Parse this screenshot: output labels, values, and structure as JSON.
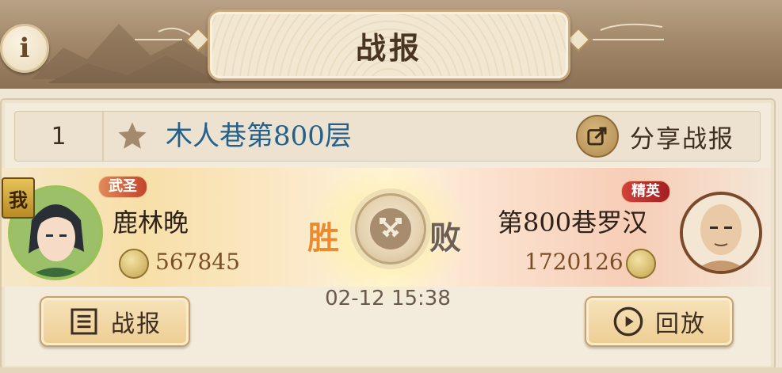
{
  "header": {
    "title": "战报",
    "info_label": "i"
  },
  "report": {
    "rank": "1",
    "level_name": "木人巷第800层",
    "share_label": "分享战报",
    "left_player": {
      "title_badge": "武圣",
      "me_badge": "我",
      "name": "鹿林晚",
      "power": "567845"
    },
    "right_player": {
      "title_badge": "精英",
      "name": "第800巷罗汉",
      "power": "1720126"
    },
    "result_left": "胜",
    "result_right": "败",
    "time": "02-12 15:38",
    "report_button": "战报",
    "replay_button": "回放"
  },
  "icons": {
    "info": "info-icon",
    "star": "star-icon",
    "share": "share-icon",
    "power": "power-coin-icon",
    "vs": "crossed-swords-icon",
    "report": "list-icon",
    "replay": "play-icon"
  },
  "colors": {
    "level_name": "#24608c",
    "win": "#ee8a2c",
    "lose": "#6e5f52",
    "title_left": "#c2452a",
    "title_right": "#a21f22"
  }
}
